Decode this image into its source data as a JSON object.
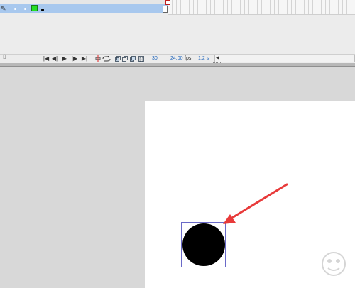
{
  "timeline": {
    "layer_color": "#25e025",
    "layer_row_color": "#a8c8ee",
    "icons": {
      "edit": "pencil-icon",
      "visibility": "dot-icon",
      "lock": "dot-icon",
      "outline": "outline-square-icon",
      "delete": "trash-icon"
    }
  },
  "status_bar": {
    "frame_number": "30",
    "fps_value": "24.00",
    "fps_label": "fps",
    "time_value": "1.2 s",
    "controls": {
      "go_first": "|◀",
      "step_back": "◀|",
      "play": "▶",
      "step_forward": "|▶",
      "go_last": "▶|",
      "loop_icon": "loop-icon",
      "center_frame_icon": "center-frame-icon",
      "onion_skin_icon": "onion-skin-icon",
      "onion_outline_icon": "onion-outline-icon",
      "edit_multiple_icon": "edit-multiple-frames-icon",
      "onion_markers_icon": "onion-markers-icon"
    },
    "scroll_left": "◀"
  },
  "stage": {
    "background": "#ffffff",
    "shape": "circle",
    "shape_color": "#000000",
    "annotation_arrow_color": "#e83a3a"
  }
}
